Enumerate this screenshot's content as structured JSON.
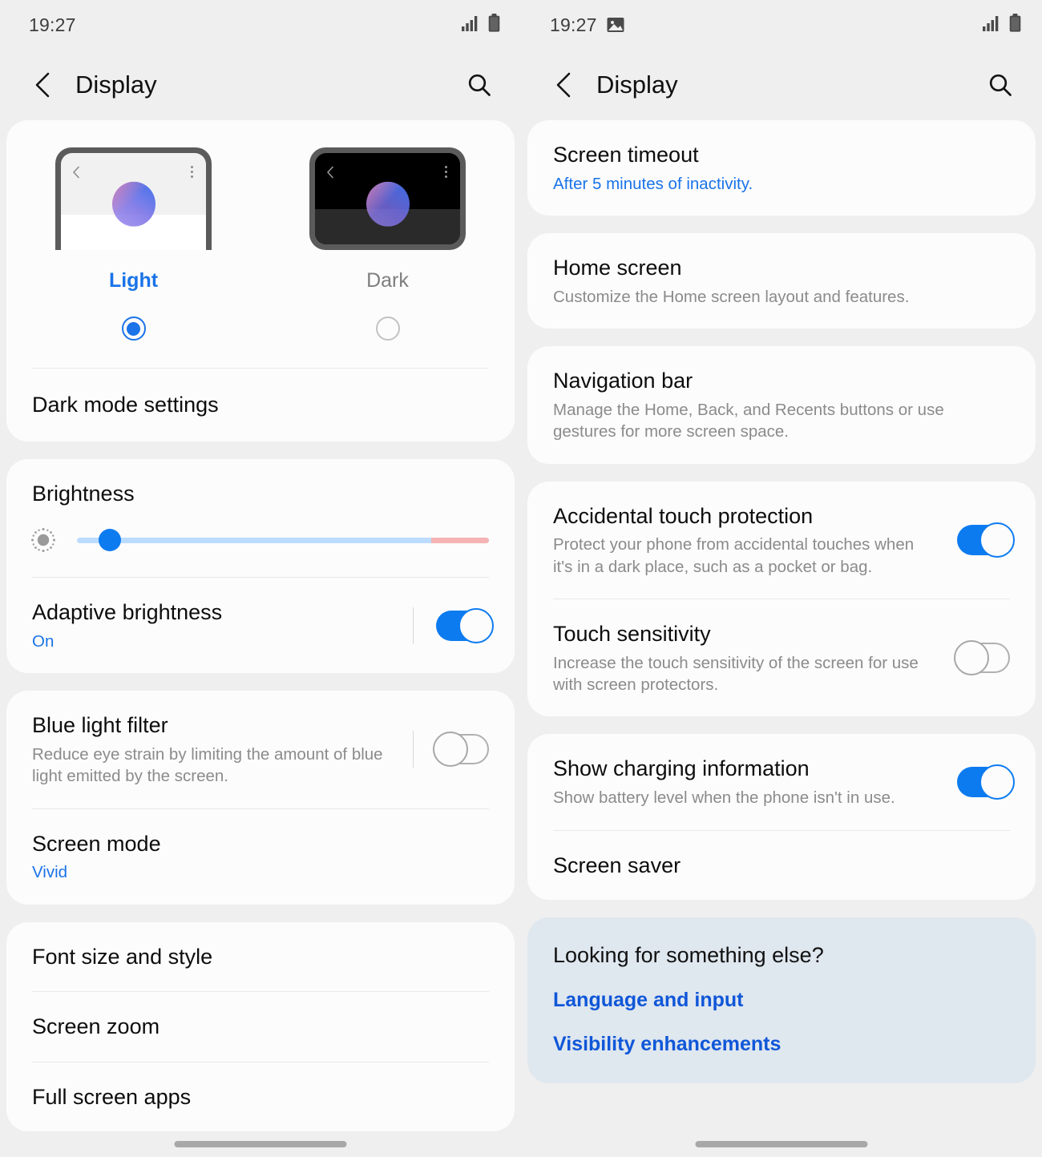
{
  "left": {
    "statusbar": {
      "time": "19:27",
      "signal_icon": "signal-bars-icon",
      "battery_icon": "battery-icon"
    },
    "appbar": {
      "back_icon": "back-chevron-icon",
      "title": "Display",
      "search_icon": "search-icon"
    },
    "theme": {
      "light_label": "Light",
      "dark_label": "Dark",
      "selected": "Light",
      "dark_mode_settings": "Dark mode settings"
    },
    "brightness": {
      "title": "Brightness",
      "icon": "brightness-sun-icon",
      "value_percent": 8,
      "warm_zone_percent": 14,
      "adaptive_title": "Adaptive brightness",
      "adaptive_value": "On",
      "adaptive_toggle": "on"
    },
    "blue_light": {
      "title": "Blue light filter",
      "subtitle": "Reduce eye strain by limiting the amount of blue light emitted by the screen.",
      "toggle": "off"
    },
    "screen_mode": {
      "title": "Screen mode",
      "value": "Vivid"
    },
    "list": [
      {
        "title": "Font size and style"
      },
      {
        "title": "Screen zoom"
      },
      {
        "title": "Full screen apps"
      }
    ]
  },
  "right": {
    "statusbar": {
      "time": "19:27",
      "image_icon": "image-screenshot-icon",
      "signal_icon": "signal-bars-icon",
      "battery_icon": "battery-icon"
    },
    "appbar": {
      "back_icon": "back-chevron-icon",
      "title": "Display",
      "search_icon": "search-icon"
    },
    "screen_timeout": {
      "title": "Screen timeout",
      "subtitle": "After 5 minutes of inactivity."
    },
    "home_screen": {
      "title": "Home screen",
      "subtitle": "Customize the Home screen layout and features."
    },
    "navigation_bar": {
      "title": "Navigation bar",
      "subtitle": "Manage the Home, Back, and Recents buttons or use gestures for more screen space."
    },
    "accidental_touch": {
      "title": "Accidental touch protection",
      "subtitle": "Protect your phone from accidental touches when it's in a dark place, such as a pocket or bag.",
      "toggle": "on"
    },
    "touch_sensitivity": {
      "title": "Touch sensitivity",
      "subtitle": "Increase the touch sensitivity of the screen for use with screen protectors.",
      "toggle": "off"
    },
    "charging_info": {
      "title": "Show charging information",
      "subtitle": "Show battery level when the phone isn't in use.",
      "toggle": "on"
    },
    "screen_saver": {
      "title": "Screen saver"
    },
    "looking_for": {
      "title": "Looking for something else?",
      "link1": "Language and input",
      "link2": "Visibility enhancements"
    }
  },
  "colors": {
    "accent_blue": "#1a73e8",
    "toggle_on": "#0d7bf0",
    "background": "#efefef",
    "card": "#fcfcfc",
    "highlight_card": "#dfe7ef",
    "slider_track": "#bcdcff",
    "slider_warm": "#f5b3b3"
  }
}
